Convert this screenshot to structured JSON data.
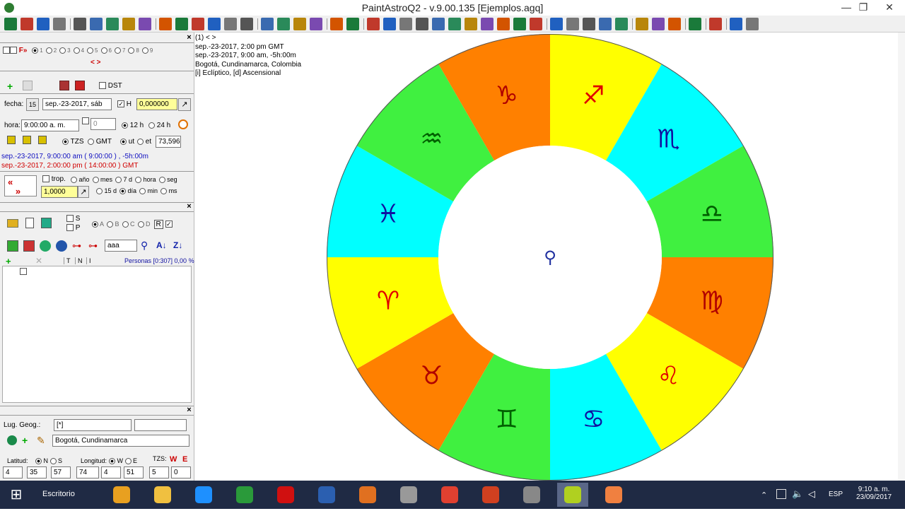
{
  "window": {
    "title": "PaintAstroQ2 - v.9.00.135  [Ejemplos.agq]",
    "minimize": "—",
    "restore": "❐",
    "close": "✕"
  },
  "toolbar_icons": [
    "gear-wheel",
    "calendar",
    "globe",
    "copy",
    "window",
    "window2",
    "window3",
    "window4",
    "window5",
    "colors",
    "gradient",
    "contrast",
    "stripes",
    "wheel-a",
    "wheel-b",
    "grid-small",
    "grid",
    "bar-chart",
    "table",
    "printer",
    "brush",
    "triangle",
    "dots",
    "fraction",
    "asterisk",
    "arrow-right",
    "sword",
    "pin",
    "brush2",
    "refresh",
    "calculator",
    "astro-a",
    "astro-b",
    "dot",
    "dots2",
    "dots3",
    "dots4",
    "wheel-c",
    "wheel-d",
    "figure",
    "book",
    "chat",
    "help",
    "exit"
  ],
  "left": {
    "panel1": {
      "header": "(1) < >",
      "f_label": "F",
      "slots": [
        "1",
        "2",
        "3",
        "4",
        "5",
        "6",
        "7",
        "8",
        "9"
      ],
      "nav_arrows": "< >",
      "dst_label": "DST",
      "fecha_label": "fecha:",
      "fecha_value": "sep.-23-2017, sáb",
      "h_label": "H",
      "h_value": "0,000000",
      "hora_label": "hora:",
      "hora_value": "9:00:00 a. m.",
      "spin_value": "0",
      "h12": "12 h",
      "h24": "24 h",
      "tzs_label": "TZS",
      "gmt_label": "GMT",
      "ut_label": "ut",
      "et_label": "et",
      "et_value": "73,596",
      "line_local": "sep.-23-2017, 9:00:00 am  ( 9:00:00 ) ,  -5h:00m",
      "line_gmt": "sep.-23-2017, 2:00:00 pm  ( 14:00:00 ) GMT",
      "trop_label": "trop.",
      "step_value": "1,0000",
      "units_row1": [
        "año",
        "mes",
        "7 d",
        "hora",
        "seg"
      ],
      "units_row2": [
        "15 d",
        "día",
        "min",
        "ms"
      ]
    },
    "panel2": {
      "s_label": "S",
      "p_label": "P",
      "groups": [
        "A",
        "B",
        "C",
        "D",
        "R"
      ],
      "search_value": "aaa",
      "cols": [
        "T",
        "N",
        "I"
      ],
      "personas": "Personas [0:307] 0,00 %"
    },
    "panel3": {
      "lug_label": "Lug. Geog.:",
      "lug_value": "[*]",
      "city_value": "Bogotá, Cundinamarca",
      "latitud_label": "Latitud:",
      "n_label": "N",
      "s_label": "S",
      "longitud_label": "Longitud:",
      "w_label": "W",
      "e_label": "E",
      "tzs_label": "TZS:",
      "w_btn": "W",
      "e_btn": "E",
      "lat_deg": "4",
      "lat_min": "35",
      "lat_sec": "57",
      "lon_deg": "74",
      "lon_min": "4",
      "lon_sec": "51",
      "tz_h": "5",
      "tz_m": "0"
    }
  },
  "chart_info": {
    "line1": "sep.-23-2017, 2:00 pm GMT",
    "line2": "sep.-23-2017, 9:00 am, -5h:00m",
    "line3": "Bogotá, Cundinamarca, Colombia",
    "line4": "[i] Eclíptico, [d] Ascensional"
  },
  "wheel": {
    "center_glyph": "⚲",
    "signs": [
      {
        "name": "capricorn",
        "glyph": "♑",
        "color": "#ff8000",
        "glyph_color": "#b00000"
      },
      {
        "name": "sagittarius",
        "glyph": "♐",
        "color": "#ffff00",
        "glyph_color": "#e00000"
      },
      {
        "name": "scorpio",
        "glyph": "♏",
        "color": "#00ffff",
        "glyph_color": "#1010a0"
      },
      {
        "name": "libra",
        "glyph": "♎",
        "color": "#40f040",
        "glyph_color": "#006000"
      },
      {
        "name": "virgo",
        "glyph": "♍",
        "color": "#ff8000",
        "glyph_color": "#b00000"
      },
      {
        "name": "leo",
        "glyph": "♌",
        "color": "#ffff00",
        "glyph_color": "#e00000"
      },
      {
        "name": "cancer",
        "glyph": "♋",
        "color": "#00ffff",
        "glyph_color": "#1010a0"
      },
      {
        "name": "gemini",
        "glyph": "♊",
        "color": "#40f040",
        "glyph_color": "#006000"
      },
      {
        "name": "taurus",
        "glyph": "♉",
        "color": "#ff8000",
        "glyph_color": "#b00000"
      },
      {
        "name": "aries",
        "glyph": "♈",
        "color": "#ffff00",
        "glyph_color": "#e00000"
      },
      {
        "name": "pisces",
        "glyph": "♓",
        "color": "#00ffff",
        "glyph_color": "#1010a0"
      },
      {
        "name": "aquarius",
        "glyph": "♒",
        "color": "#40f040",
        "glyph_color": "#006000"
      }
    ]
  },
  "taskbar": {
    "start": "⊞",
    "escritorio": "Escritorio",
    "apps": [
      "paint-icon",
      "explorer-icon",
      "ie-icon",
      "project-icon",
      "opera-icon",
      "word-icon",
      "media-icon",
      "calculator-icon",
      "chrome-icon",
      "presentation-icon",
      "palette-icon",
      "astro-icon",
      "flower-icon"
    ],
    "lang": "ESP",
    "time": "9:10 a. m.",
    "date": "23/09/2017"
  }
}
